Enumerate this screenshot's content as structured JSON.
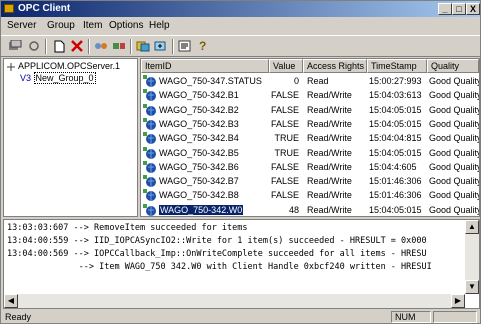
{
  "window": {
    "title": "OPC Client"
  },
  "titlebar_buttons": {
    "minimize": "_",
    "maximize": "□",
    "close": "X"
  },
  "menu": [
    "Server",
    "Group",
    "Item",
    "Options",
    "Help"
  ],
  "toolbar_icons": [
    "server-properties-icon",
    "refresh-icon",
    "new-icon",
    "delete-icon",
    "connect-icon",
    "disconnect-icon",
    "group-icon",
    "add-item-icon",
    "properties-icon",
    "help-icon"
  ],
  "tree": {
    "server": "APPLICOM.OPCServer.1",
    "group": "New_Group_0",
    "group_prefix": "V3"
  },
  "list": {
    "columns": [
      "ItemID",
      "Value",
      "Access Rights",
      "TimeStamp",
      "Quality"
    ],
    "rows": [
      {
        "id": "WAGO_750-347.STATUS",
        "value": "0",
        "access": "Read",
        "time": "15:00:27:993",
        "quality": "Good Quality"
      },
      {
        "id": "WAGO_750-342.B1",
        "value": "FALSE",
        "access": "Read/Write",
        "time": "15:04:03:613",
        "quality": "Good Quality"
      },
      {
        "id": "WAGO_750-342.B2",
        "value": "FALSE",
        "access": "Read/Write",
        "time": "15:04:05:015",
        "quality": "Good Quality"
      },
      {
        "id": "WAGO_750-342.B3",
        "value": "FALSE",
        "access": "Read/Write",
        "time": "15:04:05:015",
        "quality": "Good Quality"
      },
      {
        "id": "WAGO_750-342.B4",
        "value": "TRUE",
        "access": "Read/Write",
        "time": "15:04:04:815",
        "quality": "Good Quality"
      },
      {
        "id": "WAGO_750-342.B5",
        "value": "TRUE",
        "access": "Read/Write",
        "time": "15:04:05:015",
        "quality": "Good Quality"
      },
      {
        "id": "WAGO_750-342.B6",
        "value": "FALSE",
        "access": "Read/Write",
        "time": "15:04:4:605",
        "quality": "Good Quality"
      },
      {
        "id": "WAGO_750-342.B7",
        "value": "FALSE",
        "access": "Read/Write",
        "time": "15:01:46:306",
        "quality": "Good Quality"
      },
      {
        "id": "WAGO_750-342.B8",
        "value": "FALSE",
        "access": "Read/Write",
        "time": "15:01:46:306",
        "quality": "Good Quality"
      },
      {
        "id": "WAGO_750-342.W0",
        "value": "48",
        "access": "Read/Write",
        "time": "15:04:05:015",
        "quality": "Good Quality",
        "selected": true
      }
    ]
  },
  "log": [
    "13:03:03:607 --> RemoveItem succeeded for items",
    "13:04:00:559 --> IID_IOPCASyncIO2::Write for 1 item(s) succeeded - HRESULT = 0x000",
    "13:04:00:569 --> IOPCCallback_Imp::OnWriteComplete succeeded for all items - HRESU",
    "              --> Item WAGO_750 342.W0 with Client Handle 0xbcf240 written - HRESUI"
  ],
  "status": {
    "text": "Ready",
    "num": "NUM"
  },
  "colors": {
    "titlebar_start": "#0a246a",
    "titlebar_end": "#a6caf0",
    "selection": "#0a246a"
  }
}
